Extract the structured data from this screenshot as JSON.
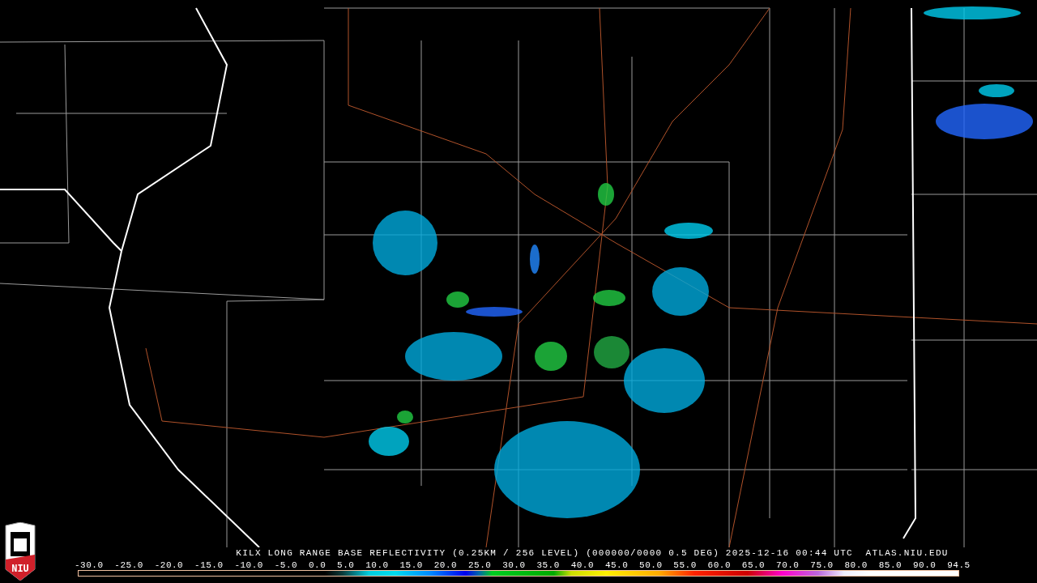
{
  "title": "KILX LONG RANGE BASE REFLECTIVITY (0.25KM / 256 LEVEL) (000000/0000 0.5 DEG) 2025-12-16 00:44 UTC  ATLAS.NIU.EDU",
  "scale": {
    "labels": [
      "-30.0",
      "-25.0",
      "-20.0",
      "-15.0",
      "-10.0",
      "-5.0",
      "0.0",
      "5.0",
      "10.0",
      "15.0",
      "20.0",
      "25.0",
      "30.0",
      "35.0",
      "40.0",
      "45.0",
      "50.0",
      "55.0",
      "60.0",
      "65.0",
      "70.0",
      "75.0",
      "80.0",
      "85.0",
      "90.0",
      "94.5"
    ]
  },
  "logo": {
    "text": "NIU"
  }
}
